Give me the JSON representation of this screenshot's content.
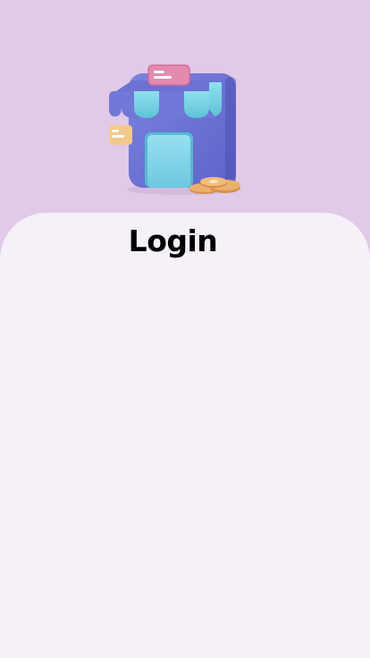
{
  "screen": {
    "title": "Login"
  },
  "hero": {
    "illustration_icon": "store-front-icon",
    "background_color": "#e1c9e8"
  },
  "card": {
    "background_color": "#f6f0f9"
  },
  "colors": {
    "store_body": "#6f76d6",
    "awning": "#7fd6e6",
    "door": "#8ad7ea",
    "sign_pink": "#e48aae",
    "sign_yellow": "#f3c98b",
    "coins": "#e7a864"
  }
}
